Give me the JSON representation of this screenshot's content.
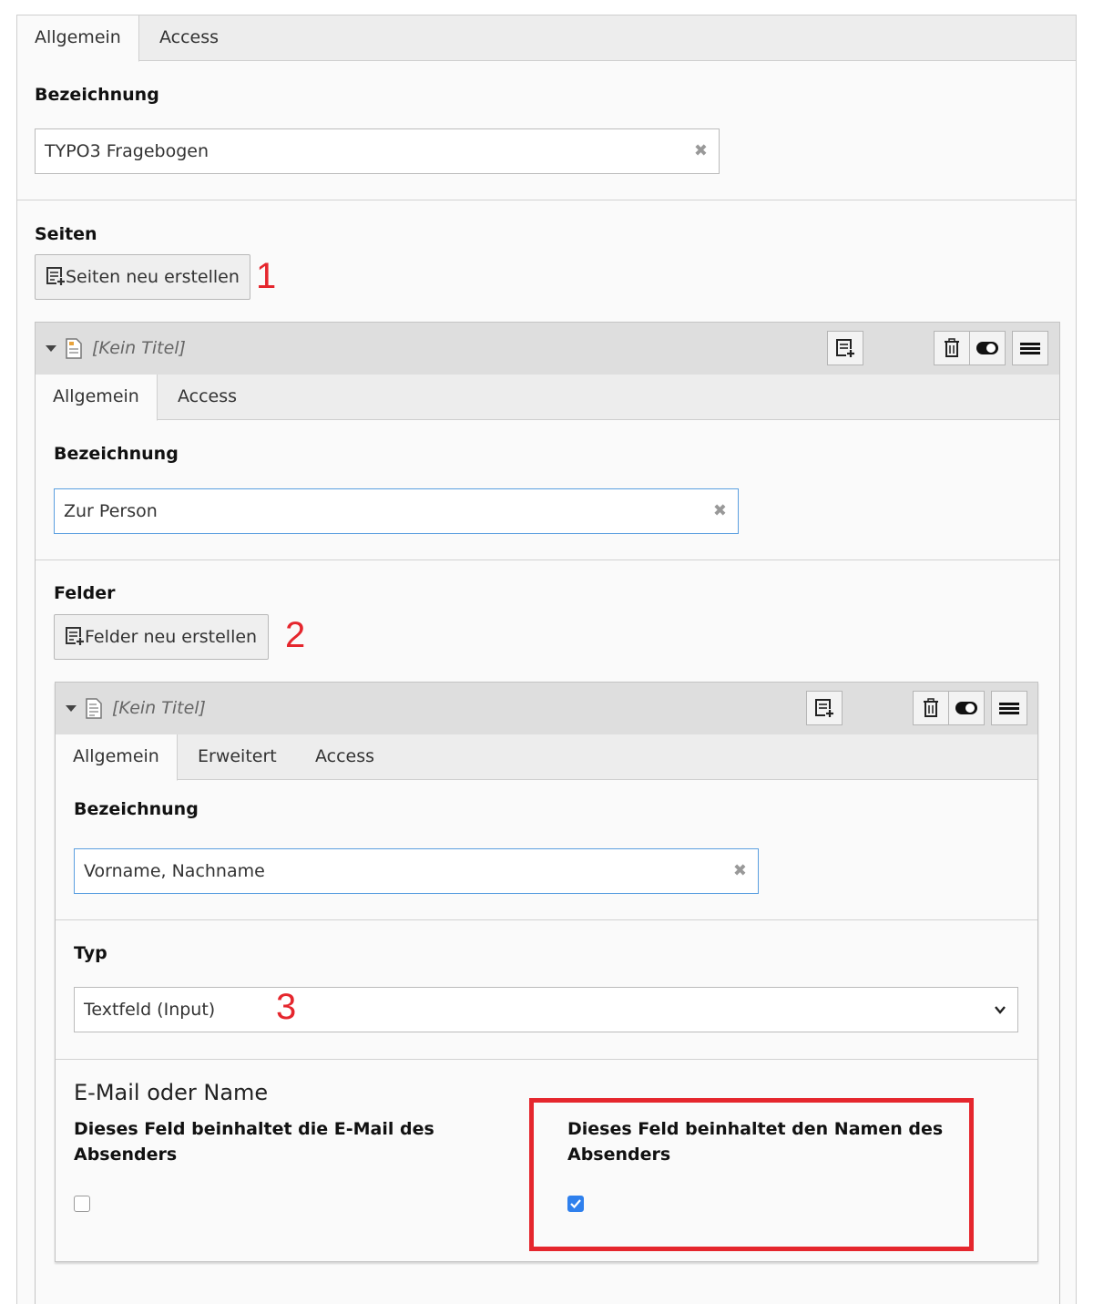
{
  "outer": {
    "tabs": [
      "Allgemein",
      "Access"
    ],
    "bezeichnung_label": "Bezeichnung",
    "bezeichnung_value": "TYPO3 Fragebogen",
    "seiten_label": "Seiten",
    "seiten_button": "Seiten neu erstellen",
    "marker": "1"
  },
  "page_record": {
    "title": "[Kein Titel]",
    "tabs": [
      "Allgemein",
      "Access"
    ],
    "bezeichnung_label": "Bezeichnung",
    "bezeichnung_value": "Zur Person",
    "felder_label": "Felder",
    "felder_button": "Felder neu erstellen",
    "marker": "2"
  },
  "field_record": {
    "title": "[Kein Titel]",
    "tabs": [
      "Allgemein",
      "Erweitert",
      "Access"
    ],
    "bezeichnung_label": "Bezeichnung",
    "bezeichnung_value": "Vorname, Nachname",
    "typ_label": "Typ",
    "typ_value": "Textfeld (Input)",
    "marker": "3",
    "section_title": "E-Mail oder Name",
    "email_checkbox_label": "Dieses Feld beinhaltet die E-Mail des Absenders",
    "email_checked": false,
    "name_checkbox_label": "Dieses Feld beinhaltet den Namen des Absenders",
    "name_checked": true
  },
  "icons": {
    "clear": "✖",
    "new_record": "new-record-icon",
    "delete": "trash-icon",
    "toggle": "toggle-icon",
    "drag": "drag-handle-icon"
  },
  "colors": {
    "annotation_red": "#e5262d",
    "focus_blue": "#5b9fe0",
    "checkbox_blue": "#2f80ed"
  }
}
